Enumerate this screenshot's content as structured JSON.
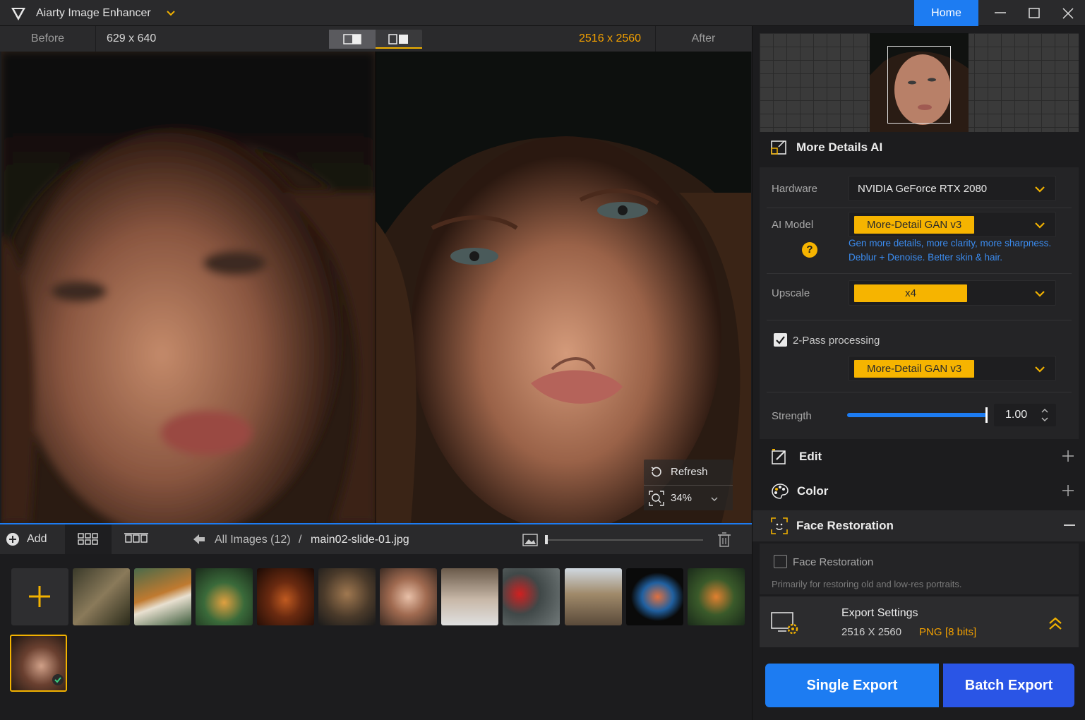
{
  "app": {
    "title": "Aiarty Image Enhancer",
    "home_label": "Home"
  },
  "compare": {
    "before_label": "Before",
    "before_size": "629 x 640",
    "after_size": "2516 x 2560",
    "after_label": "After"
  },
  "viewer": {
    "refresh_label": "Refresh",
    "zoom_label": "34%"
  },
  "gallery": {
    "add_label": "Add",
    "all_images": "All Images (12)",
    "separator": "/",
    "current_file": "main02-slide-01.jpg"
  },
  "panel": {
    "section_title": "More Details AI",
    "hardware_label": "Hardware",
    "hardware_value": "NVIDIA GeForce RTX 2080",
    "ai_model_label": "AI Model",
    "ai_model_value": "More-Detail GAN  v3",
    "ai_model_desc_1": "Gen more details, more clarity, more sharpness.",
    "ai_model_desc_2": "Deblur + Denoise. Better skin & hair.",
    "help_glyph": "?",
    "upscale_label": "Upscale",
    "upscale_value": "x4",
    "two_pass_label": "2-Pass processing",
    "two_pass_checked": true,
    "two_pass_model": "More-Detail GAN  v3",
    "strength_label": "Strength",
    "strength_value": "1.00",
    "strength_fraction": 1.0,
    "edit_title": "Edit",
    "color_title": "Color",
    "face_title": "Face Restoration",
    "face_checkbox_label": "Face Restoration",
    "face_checked": false,
    "face_note": "Primarily for restoring old and low-res portraits.",
    "export_title": "Export Settings",
    "export_res": "2516 X 2560",
    "export_format": "PNG",
    "export_bits": "[8 bits]",
    "single_export": "Single Export",
    "batch_export": "Batch Export"
  },
  "colors": {
    "accent_blue": "#1d7cf2",
    "accent_yellow": "#f6b400",
    "batch_blue": "#2a55e6"
  }
}
